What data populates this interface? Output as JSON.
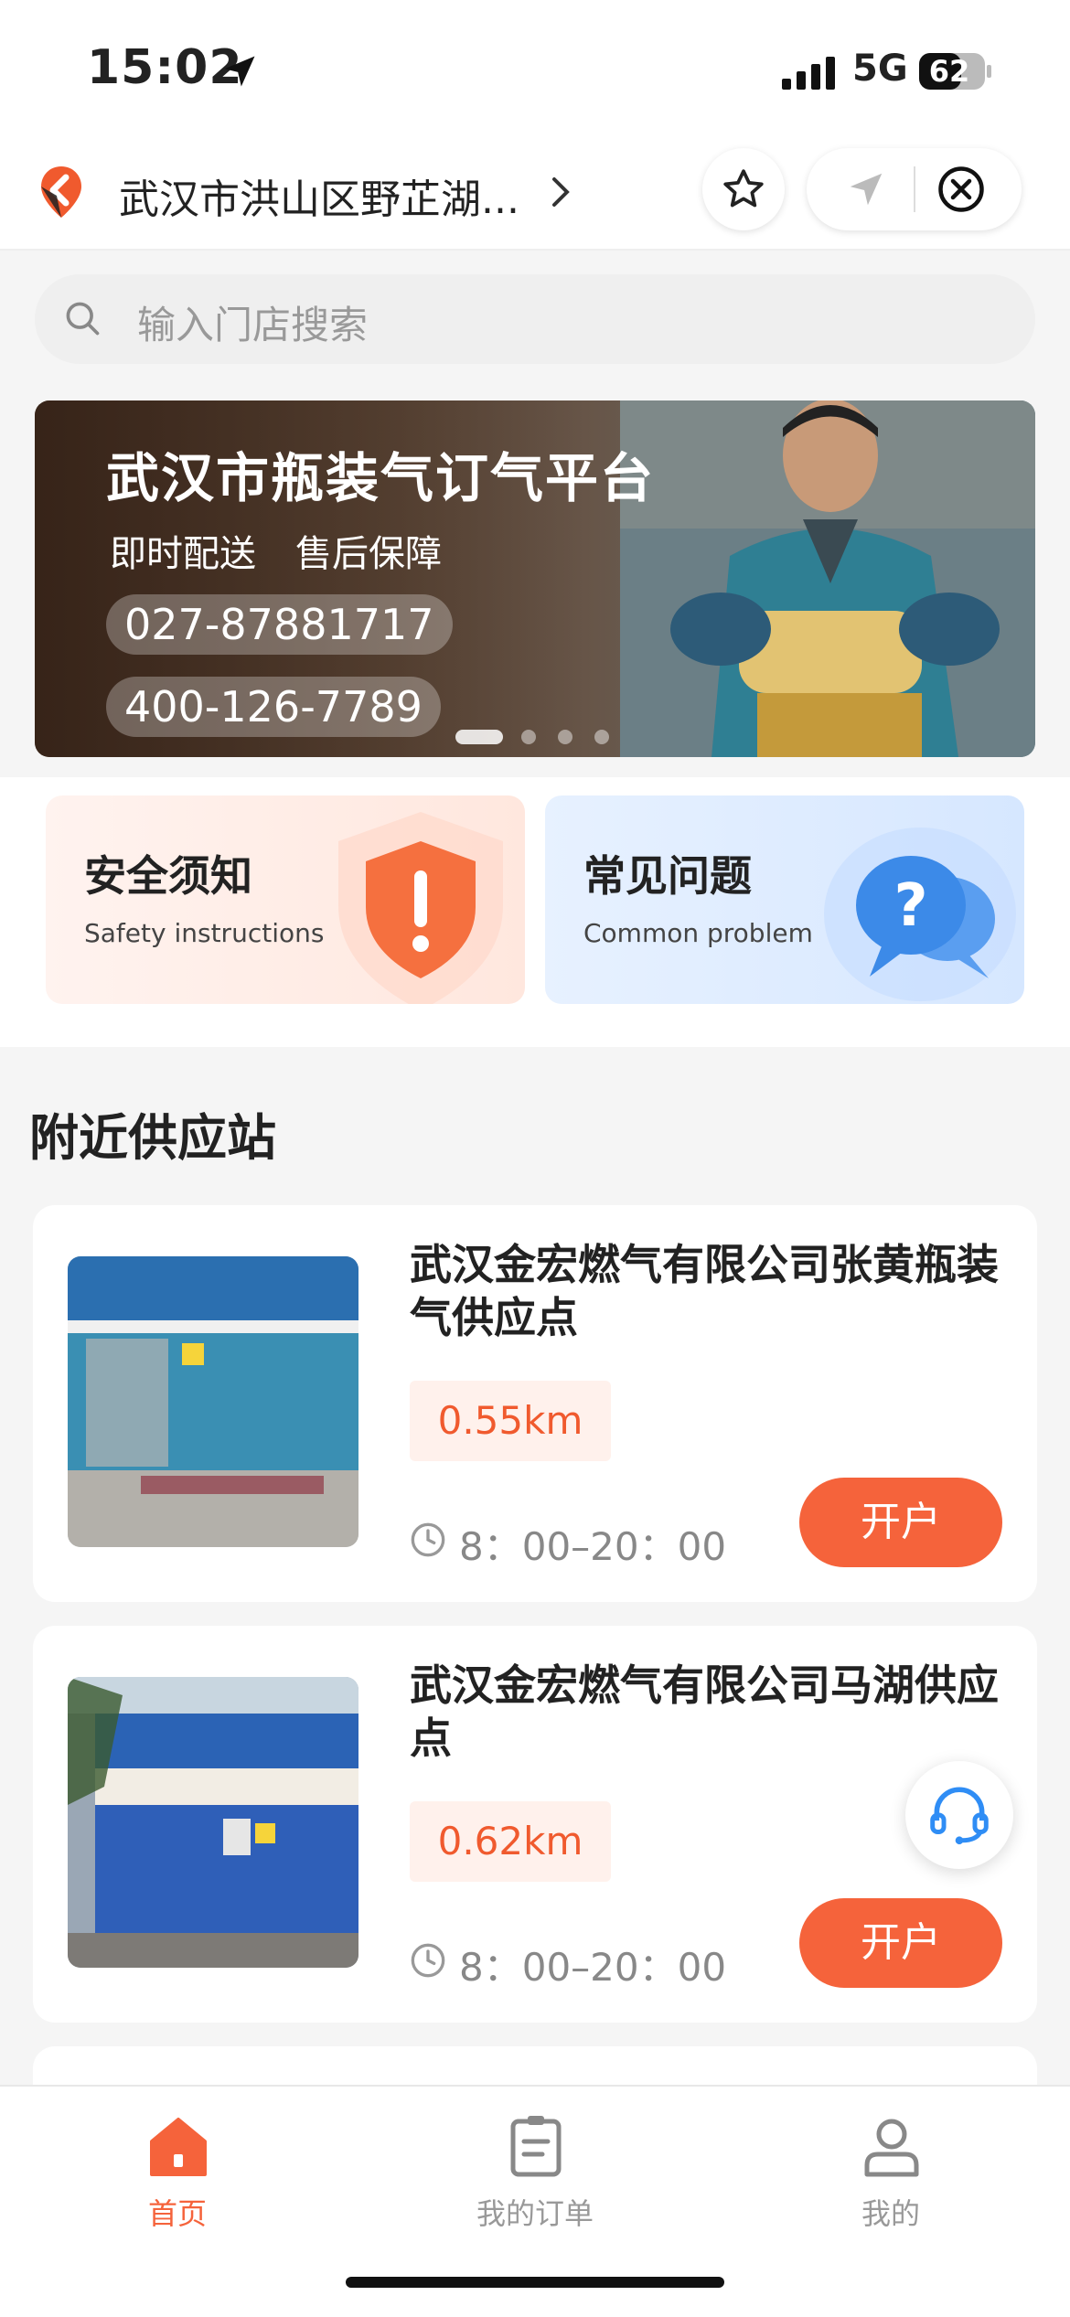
{
  "status_bar": {
    "time": "15:02",
    "network": "5G",
    "battery": "62"
  },
  "header": {
    "address": "武汉市洪山区野芷湖...",
    "icons": [
      "location-logo-icon",
      "chevron-right-icon",
      "star-icon",
      "navigate-icon",
      "close-circle-icon"
    ]
  },
  "search": {
    "placeholder": "输入门店搜索"
  },
  "banner": {
    "title": "武汉市瓶装气订气平台",
    "sub1": "即时配送",
    "sub2": "售后保障",
    "phone1": "027-87881717",
    "phone2": "400-126-7789",
    "slide_count": 4,
    "active_slide": 1
  },
  "quick_links": {
    "safety": {
      "title": "安全须知",
      "subtitle": "Safety instructions"
    },
    "faq": {
      "title": "常见问题",
      "subtitle": "Common problem"
    }
  },
  "nearby": {
    "title": "附近供应站",
    "stores": [
      {
        "name": "武汉金宏燃气有限公司张黄瓶装气供应点",
        "distance": "0.55km",
        "hours": "8：00–20：00",
        "action": "开户"
      },
      {
        "name": "武汉金宏燃气有限公司马湖供应点",
        "distance": "0.62km",
        "hours": "8：00–20：00",
        "action": "开户"
      }
    ]
  },
  "tabbar": {
    "home": "首页",
    "orders": "我的订单",
    "me": "我的"
  },
  "colors": {
    "accent": "#f5633b",
    "distance_bg": "#fff1ec"
  }
}
